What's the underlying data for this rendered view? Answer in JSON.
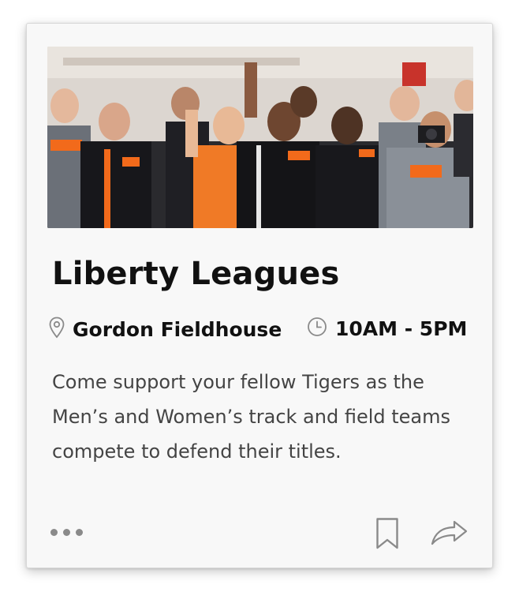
{
  "event": {
    "title": "Liberty Leagues",
    "location": "Gordon Fieldhouse",
    "time": "10AM - 5PM",
    "description": "Come support your fellow Tigers as the Men’s and Women’s track and field teams compete to defend their titles.",
    "image_subject": "crowd-of-cheering-fans"
  },
  "icons": {
    "location": "map-pin-icon",
    "time": "clock-icon",
    "more": "more-horizontal-icon",
    "bookmark": "bookmark-icon",
    "share": "share-arrow-icon"
  },
  "colors": {
    "card_background": "#f8f8f8",
    "title": "#111111",
    "description": "#444444",
    "icon": "#8a8a8a",
    "accent_orange": "#f26a1b"
  }
}
